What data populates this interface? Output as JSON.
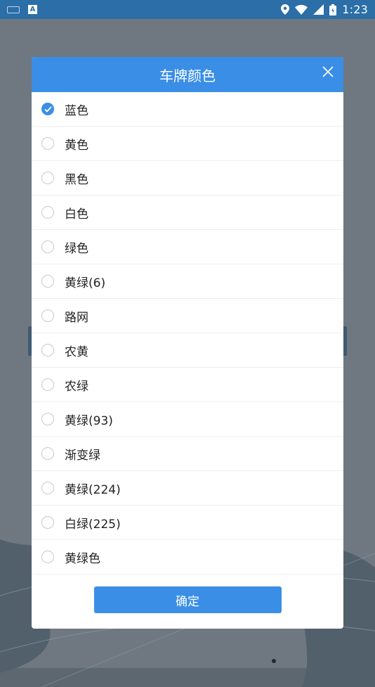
{
  "status_bar": {
    "time": "1:23",
    "left_icons": [
      "keyboard-icon",
      "a-icon"
    ],
    "right_icons": [
      "location-icon",
      "wifi-icon",
      "signal-icon",
      "battery-icon"
    ]
  },
  "dialog": {
    "title": "车牌颜色",
    "close_icon": "close-icon",
    "options": [
      {
        "label": "蓝色",
        "checked": true
      },
      {
        "label": "黄色",
        "checked": false
      },
      {
        "label": "黑色",
        "checked": false
      },
      {
        "label": "白色",
        "checked": false
      },
      {
        "label": "绿色",
        "checked": false
      },
      {
        "label": "黄绿(6)",
        "checked": false
      },
      {
        "label": "路网",
        "checked": false
      },
      {
        "label": "农黄",
        "checked": false
      },
      {
        "label": "农绿",
        "checked": false
      },
      {
        "label": "黄绿(93)",
        "checked": false
      },
      {
        "label": "渐变绿",
        "checked": false
      },
      {
        "label": "黄绿(224)",
        "checked": false
      },
      {
        "label": "白绿(225)",
        "checked": false
      },
      {
        "label": "黄绿色",
        "checked": false
      }
    ],
    "confirm_label": "确定"
  },
  "colors": {
    "accent": "#3a8ee6",
    "status_bar": "#2b6ea8",
    "overlay": "#5d6770"
  }
}
